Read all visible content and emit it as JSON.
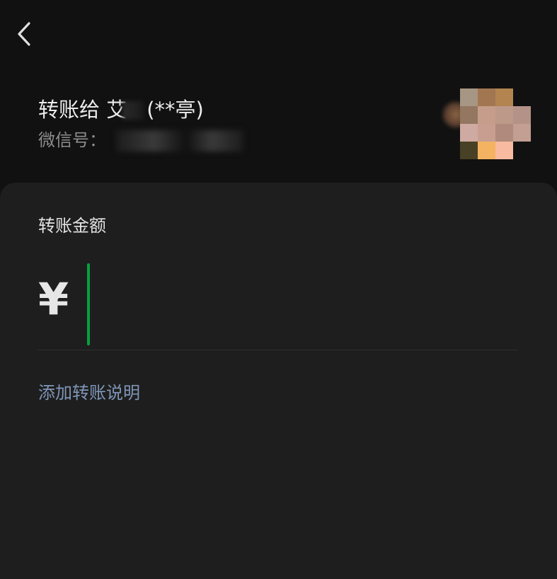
{
  "header": {
    "back_icon": "chevron-left-icon"
  },
  "recipient": {
    "title_prefix": "转账给 艾",
    "title_suffix": "(**亭)",
    "wechat_id_label": "微信号：",
    "avatar_colors": [
      [
        "#a69683",
        "#a27651",
        "#b3844f",
        "#111111"
      ],
      [
        "#937760",
        "#c59d8a",
        "#bd998a",
        "#b59287"
      ],
      [
        "#cfaaa3",
        "#c89e91",
        "#b08a7d",
        "#c29f92"
      ],
      [
        "#494125",
        "#f4b361",
        "#f8baa0",
        "#111111"
      ]
    ]
  },
  "amount": {
    "label": "转账金额",
    "currency_symbol": "¥",
    "value": "",
    "accent_color": "#07a13a"
  },
  "note": {
    "add_label": "添加转账说明",
    "link_color": "#7f96b8"
  }
}
